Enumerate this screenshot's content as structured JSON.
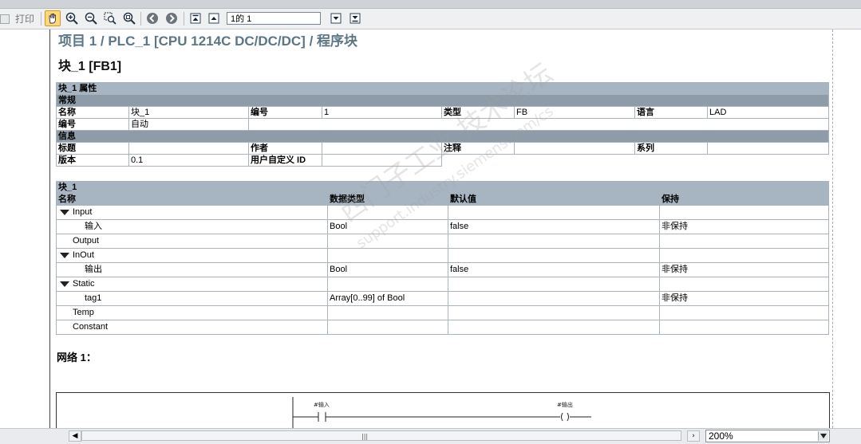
{
  "toolbar": {
    "print_label": "打印",
    "page_value": "1的 1"
  },
  "page": {
    "breadcrumb": "项目 1 / PLC_1 [CPU 1214C DC/DC/DC] / 程序块",
    "block_title": "块_1 [FB1]"
  },
  "properties": {
    "header": "块_1 属性",
    "general_header": "常规",
    "name_label": "名称",
    "name_value": "块_1",
    "number_label": "编号",
    "number_value": "1",
    "type_label": "类型",
    "type_value": "FB",
    "language_label": "语言",
    "language_value": "LAD",
    "numbering_label": "编号",
    "numbering_value": "自动",
    "info_header": "信息",
    "title_label": "标题",
    "title_value": "",
    "author_label": "作者",
    "author_value": "",
    "comment_label": "注释",
    "comment_value": "",
    "family_label": "系列",
    "family_value": "",
    "version_label": "版本",
    "version_value": "0.1",
    "userid_label": "用户自定义 ID",
    "userid_value": ""
  },
  "interface": {
    "header": "块_1",
    "columns": [
      "名称",
      "数据类型",
      "默认值",
      "保持"
    ],
    "rows": [
      {
        "name": "Input",
        "section": true,
        "type": "",
        "default": "",
        "retain": ""
      },
      {
        "name": "输入",
        "section": false,
        "type": "Bool",
        "default": "false",
        "retain": "非保持"
      },
      {
        "name": "Output",
        "section": false,
        "flat": true,
        "type": "",
        "default": "",
        "retain": ""
      },
      {
        "name": "InOut",
        "section": true,
        "type": "",
        "default": "",
        "retain": ""
      },
      {
        "name": "输出",
        "section": false,
        "type": "Bool",
        "default": "false",
        "retain": "非保持"
      },
      {
        "name": "Static",
        "section": true,
        "type": "",
        "default": "",
        "retain": ""
      },
      {
        "name": "tag1",
        "section": false,
        "type": "Array[0..99] of Bool",
        "default": "",
        "retain": "非保持"
      },
      {
        "name": "Temp",
        "section": false,
        "flat": true,
        "type": "",
        "default": "",
        "retain": ""
      },
      {
        "name": "Constant",
        "section": false,
        "flat": true,
        "type": "",
        "default": "",
        "retain": ""
      }
    ]
  },
  "network": {
    "label": "网络 1：",
    "contact_tag": "#输入",
    "coil_tag": "#输出"
  },
  "watermark": {
    "line1": "西门子工业 技术论坛",
    "line2": "support.industry.siemens.com/cs"
  },
  "statusbar": {
    "zoom_value": "200%"
  }
}
